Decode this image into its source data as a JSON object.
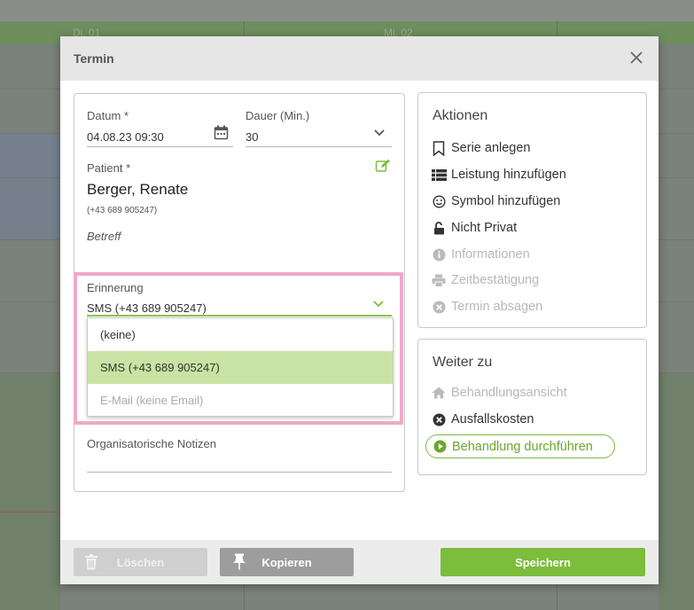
{
  "background": {
    "day_headers": [
      "Di. 01",
      "Mi. 02"
    ]
  },
  "dialog": {
    "title": "Termin",
    "close_label": "×"
  },
  "form": {
    "date_label": "Datum  *",
    "date_value": "04.08.23 09:30",
    "duration_label": "Dauer (Min.)",
    "duration_value": "30",
    "patient_label": "Patient  *",
    "patient_name": "Berger, Renate",
    "patient_phone": "(+43 689 905247)",
    "subject_placeholder": "Betreff",
    "reminder_label": "Erinnerung",
    "reminder_value": "SMS (+43 689 905247)",
    "reminder_options": [
      {
        "label": "(keine)",
        "state": "normal"
      },
      {
        "label": "SMS (+43 689 905247)",
        "state": "selected"
      },
      {
        "label": "E-Mail (keine Email)",
        "state": "disabled"
      }
    ],
    "org_notes_label": "Organisatorische Notizen"
  },
  "actions": {
    "title": "Aktionen",
    "items": [
      {
        "label": "Serie anlegen",
        "icon": "bookmark-icon",
        "enabled": true
      },
      {
        "label": "Leistung hinzufügen",
        "icon": "list-icon",
        "enabled": true
      },
      {
        "label": "Symbol hinzufügen",
        "icon": "smiley-icon",
        "enabled": true
      },
      {
        "label": "Nicht Privat",
        "icon": "unlock-icon",
        "enabled": true
      },
      {
        "label": "Informationen",
        "icon": "info-icon",
        "enabled": false
      },
      {
        "label": "Zeitbestätigung",
        "icon": "print-icon",
        "enabled": false
      },
      {
        "label": "Termin absagen",
        "icon": "cancel-circle-icon",
        "enabled": false
      }
    ]
  },
  "goto": {
    "title": "Weiter zu",
    "items": [
      {
        "label": "Behandlungsansicht",
        "icon": "home-icon",
        "enabled": false
      },
      {
        "label": "Ausfallskosten",
        "icon": "x-circle-icon",
        "enabled": true
      }
    ],
    "primary_label": "Behandlung durchführen"
  },
  "footer": {
    "delete_label": "Löschen",
    "copy_label": "Kopieren",
    "save_label": "Speichern"
  },
  "colors": {
    "accent_green": "#7cbd3c",
    "selected_option_bg": "#c9e3a4",
    "highlight_pink": "#f0a8c8"
  }
}
